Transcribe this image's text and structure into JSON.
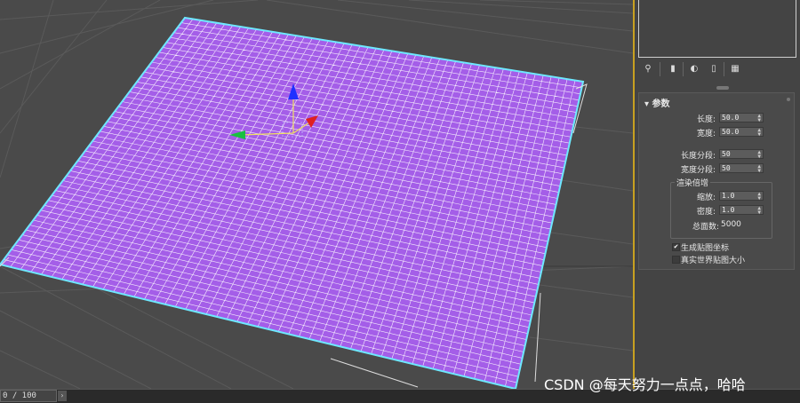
{
  "viewport": {
    "grid_color": "#8a8a8a",
    "plane_fill": "#a45ee8",
    "plane_edge": "#6ee8ff",
    "gizmo_axes": [
      "x-red",
      "y-green",
      "z-blue"
    ]
  },
  "toolbar": {
    "icons": [
      "pin-icon",
      "modifier-stack-icon",
      "show-end-result-icon",
      "make-unique-icon",
      "configure-modifier-sets-icon"
    ]
  },
  "parameters": {
    "title": "参数",
    "length_label": "长度:",
    "length_value": "50.0",
    "width_label": "宽度:",
    "width_value": "50.0",
    "length_segs_label": "长度分段:",
    "length_segs_value": "50",
    "width_segs_label": "宽度分段:",
    "width_segs_value": "50",
    "render_group_title": "渲染倍增",
    "scale_label": "缩放:",
    "scale_value": "1.0",
    "density_label": "密度:",
    "density_value": "1.0",
    "total_faces_label": "总面数:",
    "total_faces_value": "5000",
    "gen_mapping_label": "生成贴图坐标",
    "gen_mapping_checked": true,
    "real_world_label": "真实世界贴图大小",
    "real_world_checked": false
  },
  "timeline": {
    "frame_text": "0 / 100"
  },
  "watermark": "CSDN @每天努力一点点，哈哈"
}
